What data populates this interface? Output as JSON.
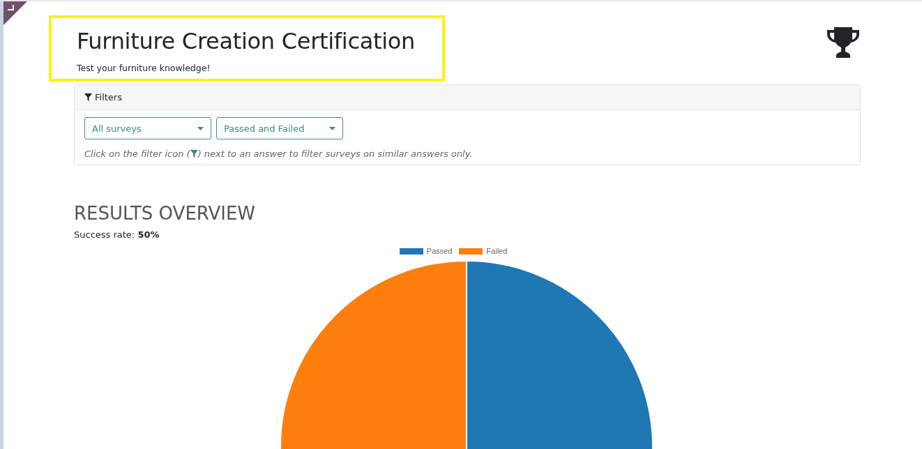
{
  "header": {
    "title": "Furniture Creation Certification",
    "subtitle": "Test your furniture knowledge!",
    "highlighted": true
  },
  "filters": {
    "title": "Filters",
    "dropdowns": [
      {
        "value": "All surveys"
      },
      {
        "value": "Passed and Failed"
      }
    ],
    "hint_before": "Click on the filter icon (",
    "hint_after": ") next to an answer to filter surveys on similar answers only."
  },
  "results": {
    "heading": "RESULTS OVERVIEW",
    "success_label": "Success rate:",
    "success_value": "50%",
    "chart_data": {
      "type": "pie",
      "categories": [
        "Passed",
        "Failed"
      ],
      "values": [
        50,
        50
      ],
      "colors": [
        "#1f77b4",
        "#ff7f0e"
      ]
    }
  }
}
